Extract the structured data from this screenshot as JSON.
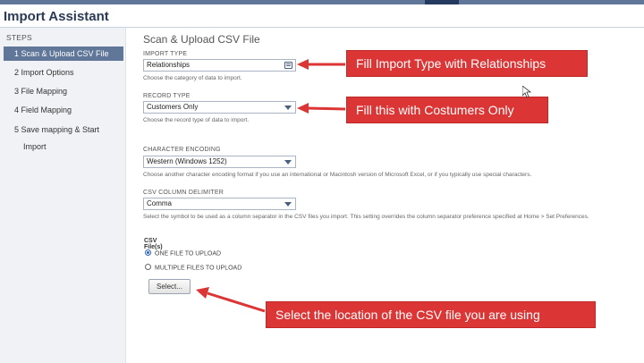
{
  "app": {
    "title": "Import Assistant"
  },
  "sidebar": {
    "heading": "STEPS",
    "steps": [
      {
        "label": "1 Scan & Upload CSV File"
      },
      {
        "label": "2 Import Options"
      },
      {
        "label": "3 File Mapping"
      },
      {
        "label": "4 Field Mapping"
      },
      {
        "label": "5 Save mapping & Start",
        "continuation": "Import"
      }
    ]
  },
  "main": {
    "section_title": "Scan & Upload CSV File",
    "import_type": {
      "label": "IMPORT TYPE",
      "value": "Relationships",
      "help": "Choose the category of data to import."
    },
    "record_type": {
      "label": "RECORD TYPE",
      "value": "Customers Only",
      "help": "Choose the record type of data to import."
    },
    "character_encoding": {
      "label": "CHARACTER ENCODING",
      "value": "Western (Windows 1252)",
      "help": "Choose another character encoding format if you use an international or Macintosh version of Microsoft Excel, or if you typically use special characters."
    },
    "csv_delimiter": {
      "label": "CSV COLUMN DELIMITER",
      "value": "Comma",
      "help": "Select the symbol to be used as a column separator in the CSV files you import. This setting overrides the column separator preference specified at Home > Set Preferences."
    },
    "csv_files": {
      "label": "CSV File(s)",
      "options": [
        {
          "label": "ONE FILE TO UPLOAD",
          "selected": true
        },
        {
          "label": "MULTIPLE FILES TO UPLOAD",
          "selected": false
        }
      ],
      "select_button": "Select..."
    }
  },
  "annotations": [
    {
      "text": "Fill Import Type with Relationships"
    },
    {
      "text": "Fill this with Costumers Only"
    },
    {
      "text": "Select the location of the CSV file you are using"
    }
  ],
  "colors": {
    "accent": "#607799",
    "callout": "#dc3535",
    "title": "#2b3a55"
  }
}
